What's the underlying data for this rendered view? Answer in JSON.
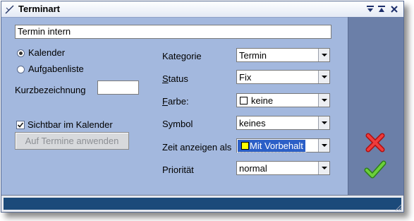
{
  "window": {
    "title": "Terminart"
  },
  "form": {
    "name_value": "Termin intern",
    "radio_kalender": "Kalender",
    "radio_aufgabenliste": "Aufgabenliste",
    "kurzbezeichnung_label": "Kurzbezeichnung",
    "kurzbezeichnung_value": "",
    "sichtbar_label": "Sichtbar im Kalender",
    "sichtbar_checked": true,
    "apply_button": "Auf Termine anwenden"
  },
  "fields": {
    "kategorie": {
      "label": "Kategorie",
      "value": "Termin"
    },
    "status": {
      "label_first": "S",
      "label_rest": "tatus",
      "value": "Fix"
    },
    "farbe": {
      "label_first": "F",
      "label_rest": "arbe:",
      "value": "keine",
      "swatch_color": "#ffffff"
    },
    "symbol": {
      "label": "Symbol",
      "value": "keines"
    },
    "zeit": {
      "label": "Zeit anzeigen als",
      "value": "Mit Vorbehalt",
      "swatch_color": "#ffff00"
    },
    "prioritaet": {
      "label": "Priorität",
      "value": "normal"
    }
  },
  "actions": {
    "cancel_icon": "red-x-icon",
    "confirm_icon": "green-check-icon"
  },
  "colors": {
    "panel_bg": "#a3b8de",
    "side_panel": "#6b7fa8",
    "status_bar": "#1b4a7a",
    "selection": "#2b5fc7"
  }
}
